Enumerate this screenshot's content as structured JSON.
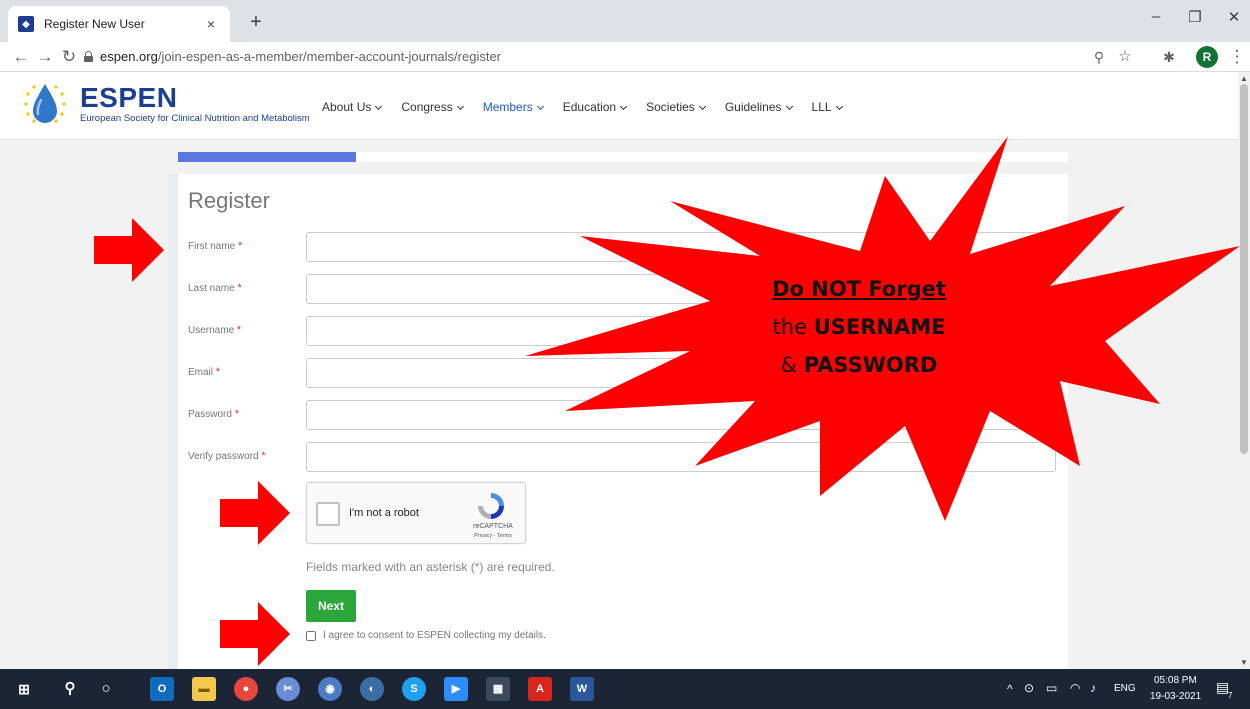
{
  "browser": {
    "tab_title": "Register New User",
    "tab_close": "×",
    "new_tab": "+",
    "url_host": "espen.org",
    "url_path": "/join-espen-as-a-member/member-account-journals/register",
    "profile_initial": "R"
  },
  "site": {
    "logo_name": "ESPEN",
    "logo_subtitle": "European Society for Clinical Nutrition and Metabolism",
    "nav": [
      {
        "label": "About Us",
        "active": false
      },
      {
        "label": "Congress",
        "active": false
      },
      {
        "label": "Members",
        "active": true
      },
      {
        "label": "Education",
        "active": false
      },
      {
        "label": "Societies",
        "active": false
      },
      {
        "label": "Guidelines",
        "active": false
      },
      {
        "label": "LLL",
        "active": false
      }
    ],
    "progress_fraction": 0.2
  },
  "form": {
    "title": "Register",
    "required_marker": "*",
    "fields": [
      {
        "label": "First name",
        "value": ""
      },
      {
        "label": "Last name",
        "value": ""
      },
      {
        "label": "Username",
        "value": ""
      },
      {
        "label": "Email",
        "value": ""
      },
      {
        "label": "Password",
        "value": ""
      },
      {
        "label": "Verify password",
        "value": ""
      }
    ],
    "captcha": {
      "label": "I'm not a robot",
      "brand": "reCAPTCHA",
      "links": "Privacy - Terms"
    },
    "required_note": "Fields marked with an asterisk (*) are required.",
    "next_label": "Next",
    "consent_label": "I agree to consent to ESPEN collecting my details."
  },
  "annotation": {
    "line1": "Do NOT Forget",
    "line2_prefix": "the ",
    "line2_bold": "USERNAME",
    "line3_prefix": "& ",
    "line3_bold": "PASSWORD",
    "color": "#ff0000"
  },
  "taskbar": {
    "lang": "ENG",
    "time": "05:08 PM",
    "date": "19-03-2021",
    "notification_count": "7"
  },
  "colors": {
    "brand": "#1c3f94",
    "progress": "#5a77e0",
    "next_button": "#2aa63a",
    "required": "#e0322c"
  }
}
